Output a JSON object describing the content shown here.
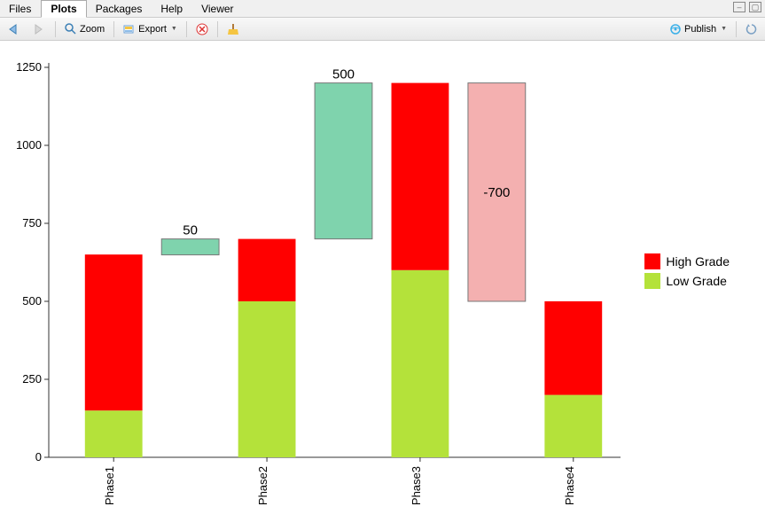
{
  "tabs": {
    "files": "Files",
    "plots": "Plots",
    "packages": "Packages",
    "help": "Help",
    "viewer": "Viewer"
  },
  "toolbar": {
    "zoom": "Zoom",
    "export": "Export",
    "publish": "Publish"
  },
  "chart_data": {
    "type": "bar",
    "categories": [
      "Phase1",
      "Phase2",
      "Phase3",
      "Phase4"
    ],
    "series": [
      {
        "name": "Low Grade",
        "values": [
          150,
          500,
          600,
          200
        ],
        "color": "#b4e23a"
      },
      {
        "name": "High Grade",
        "values": [
          500,
          200,
          600,
          300
        ],
        "color": "#ff0000"
      }
    ],
    "connectors": [
      {
        "after_index": 0,
        "from": 650,
        "to": 700,
        "label": "50",
        "fill": "#7fd3ad",
        "stroke": "#777"
      },
      {
        "after_index": 1,
        "from": 700,
        "to": 1200,
        "label": "500",
        "fill": "#7fd3ad",
        "stroke": "#777"
      },
      {
        "after_index": 2,
        "from": 1200,
        "to": 500,
        "label": "-700",
        "fill": "#f4b0b0",
        "stroke": "#777"
      }
    ],
    "ylim": [
      0,
      1250
    ],
    "yticks": [
      0,
      250,
      500,
      750,
      1000,
      1250
    ],
    "title": "",
    "xlabel": "",
    "ylabel": ""
  },
  "legend": {
    "high": "High Grade",
    "low": "Low Grade"
  },
  "colors": {
    "high": "#ff0000",
    "low": "#b4e23a",
    "connector_pos": "#7fd3ad",
    "connector_neg": "#f4b0b0",
    "axis": "#333"
  }
}
